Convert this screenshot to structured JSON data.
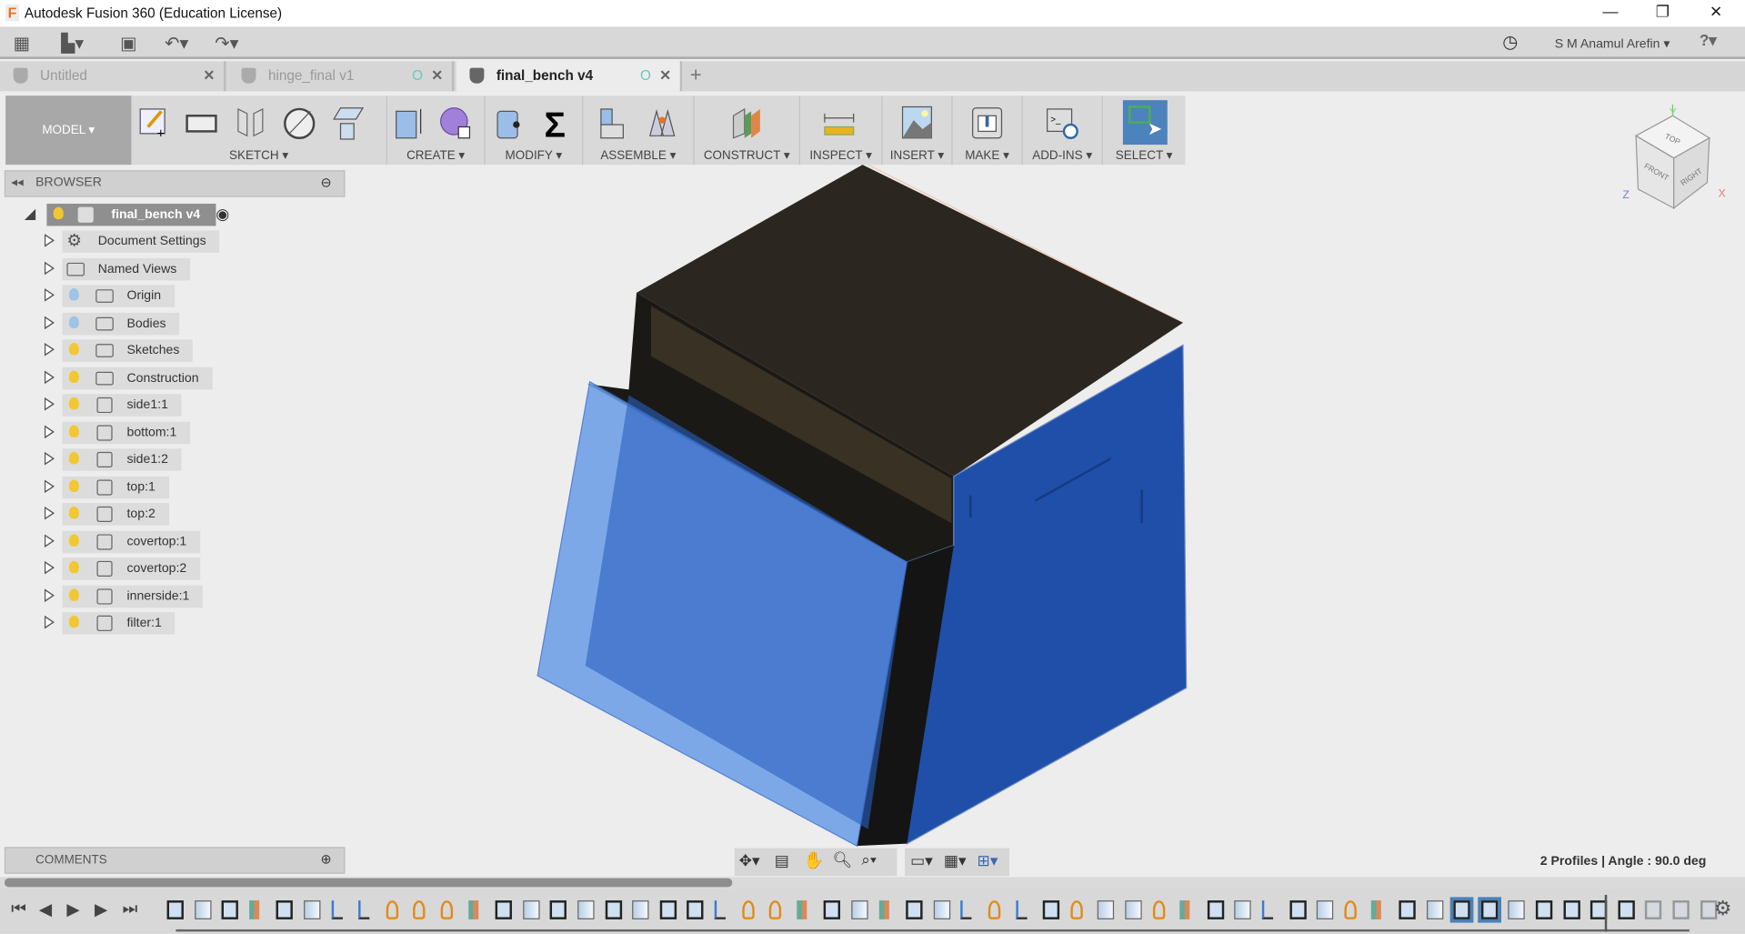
{
  "window": {
    "title": "Autodesk Fusion 360 (Education License)",
    "minimize": "—",
    "restore": "❐",
    "close": "✕"
  },
  "qat": {
    "user": "S M Anamul Arefin ▾",
    "help": "?▾"
  },
  "tabs": [
    {
      "label": "Untitled",
      "active": false,
      "close": "✕"
    },
    {
      "label": "hinge_final v1",
      "active": false,
      "close": "✕",
      "status": "O"
    },
    {
      "label": "final_bench v4",
      "active": true,
      "close": "✕",
      "status": "O"
    }
  ],
  "new_tab": "+",
  "toolbar": {
    "workspace": "MODEL ▾",
    "groups": [
      {
        "label": "SKETCH ▾"
      },
      {
        "label": "CREATE ▾"
      },
      {
        "label": "MODIFY ▾"
      },
      {
        "label": "ASSEMBLE ▾"
      },
      {
        "label": "CONSTRUCT ▾"
      },
      {
        "label": "INSPECT ▾"
      },
      {
        "label": "INSERT ▾"
      },
      {
        "label": "MAKE ▾"
      },
      {
        "label": "ADD-INS ▾"
      },
      {
        "label": "SELECT ▾"
      }
    ]
  },
  "browser": {
    "title": "BROWSER",
    "root": "final_bench v4",
    "items": [
      {
        "label": "Document Settings",
        "icon": "gear-icon"
      },
      {
        "label": "Named Views",
        "icon": "folder-icon"
      },
      {
        "label": "Origin",
        "icon": "folder-icon",
        "bulb": "off"
      },
      {
        "label": "Bodies",
        "icon": "folder-icon",
        "bulb": "off"
      },
      {
        "label": "Sketches",
        "icon": "folder-icon",
        "bulb": "on"
      },
      {
        "label": "Construction",
        "icon": "folder-icon",
        "bulb": "on"
      },
      {
        "label": "side1:1",
        "icon": "component-icon",
        "bulb": "on"
      },
      {
        "label": "bottom:1",
        "icon": "component-icon",
        "bulb": "on"
      },
      {
        "label": "side1:2",
        "icon": "component-icon",
        "bulb": "on"
      },
      {
        "label": "top:1",
        "icon": "component-icon",
        "bulb": "on"
      },
      {
        "label": "top:2",
        "icon": "component-icon",
        "bulb": "on"
      },
      {
        "label": "covertop:1",
        "icon": "component-icon",
        "bulb": "on"
      },
      {
        "label": "covertop:2",
        "icon": "component-icon",
        "bulb": "on"
      },
      {
        "label": "innerside:1",
        "icon": "component-icon",
        "bulb": "on"
      },
      {
        "label": "filter:1",
        "icon": "component-icon",
        "bulb": "on"
      }
    ]
  },
  "comments": {
    "title": "COMMENTS"
  },
  "viewcube": {
    "top": "TOP",
    "front": "FRONT",
    "right": "RIGHT",
    "x": "X",
    "y": "Y",
    "z": "Z"
  },
  "status": "2 Profiles | Angle : 90.0 deg",
  "timeline": {
    "controls": [
      "⏮",
      "◀",
      "▶",
      "▶",
      "⏭"
    ],
    "features": "s e s c s e j j a a a c s e s e s e s s j a a c s e c s e j a j s a e e o c s e j s e a c s e S S e s s s s d d d"
  },
  "colors": {
    "accent": "#4a80b8",
    "selected_face": "#1f4fa8",
    "transparent_face": "#6a9de8"
  }
}
